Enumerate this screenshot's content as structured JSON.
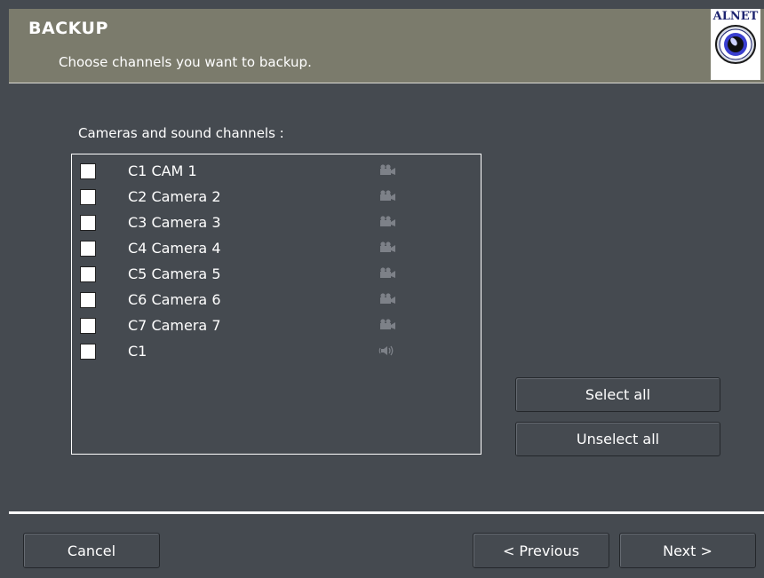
{
  "header": {
    "title": "BACKUP",
    "subtitle": "Choose channels you want to backup.",
    "logo_text": "ALNET"
  },
  "list": {
    "label": "Cameras and sound channels :",
    "items": [
      {
        "label": "C1 CAM 1",
        "type": "camera-icon",
        "checked": false
      },
      {
        "label": "C2 Camera 2",
        "type": "camera-icon",
        "checked": false
      },
      {
        "label": "C3 Camera 3",
        "type": "camera-icon",
        "checked": false
      },
      {
        "label": "C4 Camera 4",
        "type": "camera-icon",
        "checked": false
      },
      {
        "label": "C5 Camera 5",
        "type": "camera-icon",
        "checked": false
      },
      {
        "label": "C6 Camera 6",
        "type": "camera-icon",
        "checked": false
      },
      {
        "label": "C7 Camera 7",
        "type": "camera-icon",
        "checked": false
      },
      {
        "label": "C1",
        "type": "speaker-icon",
        "checked": false
      }
    ]
  },
  "actions": {
    "select_all": "Select all",
    "unselect_all": "Unselect all"
  },
  "footer": {
    "cancel": "Cancel",
    "previous": "< Previous",
    "next": "Next >"
  },
  "colors": {
    "background": "#454a50",
    "header": "#7b7b6c",
    "logo_text": "#1d2470"
  }
}
